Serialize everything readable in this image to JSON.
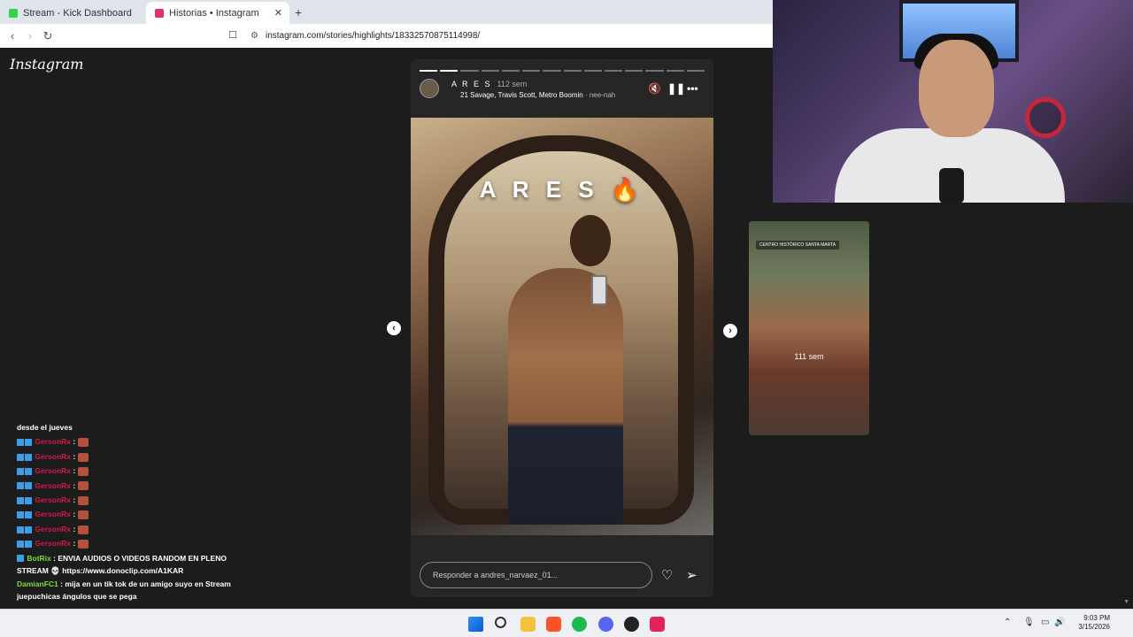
{
  "browser": {
    "tabs": [
      {
        "title": "Stream - Kick Dashboard",
        "color": "#2fd34a"
      },
      {
        "title": "Historias • Instagram",
        "color": "#e1306c"
      }
    ],
    "url": "instagram.com/stories/highlights/18332570875114998/"
  },
  "instagram": {
    "logo": "Instagram",
    "story": {
      "username": "A R E S",
      "age": "112 sem",
      "music_artists": "21 Savage, Travis Scott, Metro Boomin",
      "music_song": "· nee-nah",
      "overlay_text": "A R E S 🔥",
      "reply_placeholder": "Responder a andres_narvaez_01...",
      "progress_total_segments": 14,
      "progress_done_segments": 2
    },
    "next_story": {
      "location": "CENTRO HISTÓRICO SANTA MARTA",
      "age": "111 sem"
    }
  },
  "chat": {
    "messages": [
      {
        "user": "",
        "text": "desde el jueves"
      },
      {
        "user": "GersonRx",
        "text": ":"
      },
      {
        "user": "GersonRx",
        "text": ":"
      },
      {
        "user": "GersonRx",
        "text": ":"
      },
      {
        "user": "GersonRx",
        "text": ":"
      },
      {
        "user": "GersonRx",
        "text": ":"
      },
      {
        "user": "GersonRx",
        "text": ":"
      },
      {
        "user": "GersonRx",
        "text": ":"
      },
      {
        "user": "GersonRx",
        "text": ":"
      }
    ],
    "botrix": {
      "user": "BotRix",
      "text": ": ENVIA AUDIOS O VIDEOS RANDOM EN PLENO STREAM 💀 https://www.donoclip.com/A1KAR"
    },
    "damian": {
      "user": "DamianFC1",
      "text": ": mija en un tik tok de un amigo suyo en Stream juepuchicas ángulos que se pega"
    }
  },
  "taskbar": {
    "time": "9:03 PM",
    "date": "3/15/2026"
  },
  "colors": {
    "page_bg": "#1c1c1c",
    "chat_user_gerson": "#d11a4a",
    "chat_user_bot": "#7bdc3a"
  }
}
